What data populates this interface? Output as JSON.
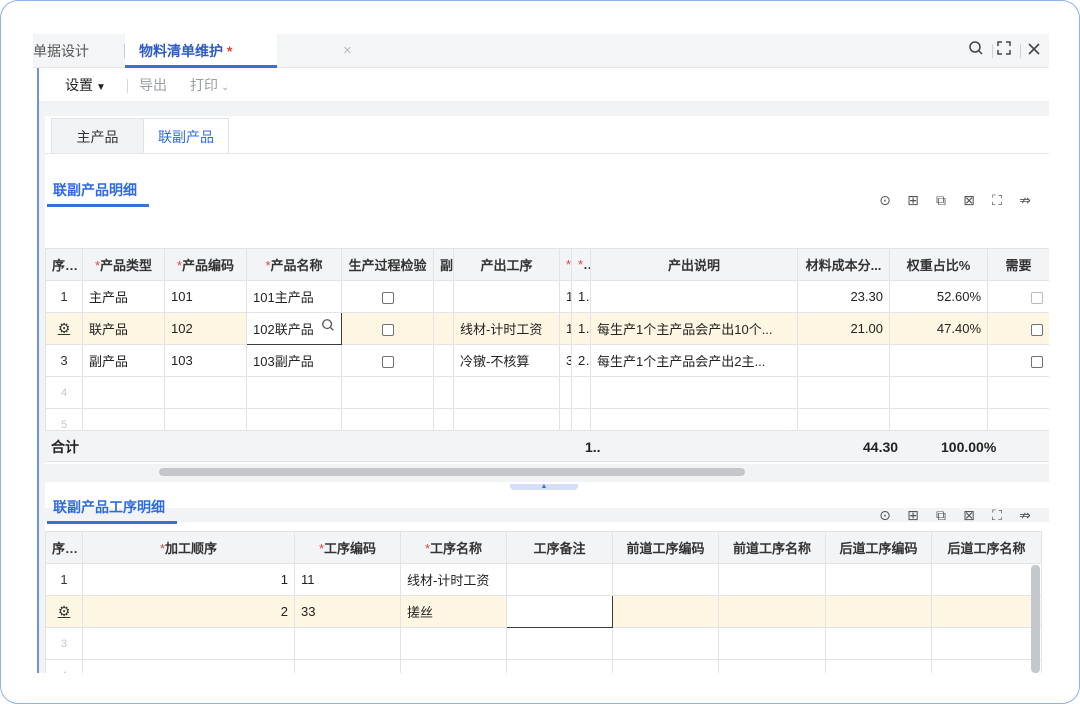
{
  "tabs": {
    "prev_label": "单据设计",
    "active_label": "物料清单维护",
    "active_star": "*",
    "close_glyph": "×"
  },
  "window_icons": {
    "search": "search-icon",
    "expand": "expand-icon",
    "close": "close-icon"
  },
  "toolbar": {
    "settings": "设置",
    "export": "导出",
    "print": "打印"
  },
  "subtabs": {
    "main": "主产品",
    "co": "联副产品"
  },
  "section1": {
    "title": "联副产品明细",
    "headers": [
      "序号",
      "产品类型",
      "产品编码",
      "产品名称",
      "生产过程检验",
      "副",
      "产出工序",
      "",
      "..",
      "产出说明",
      "材料成本分...",
      "权重占比%",
      "需要"
    ],
    "rows": [
      {
        "idx": "1",
        "type": "主产品",
        "code": "101",
        "name": "101主产品",
        "proc": "",
        "col_a": "1",
        "col_b": "1",
        "desc": "",
        "cost": "23.30",
        "weight": "52.60%"
      },
      {
        "idx": "",
        "type": "联产品",
        "code": "102",
        "name": "102联产品",
        "proc": "线材-计时工资",
        "col_a": "1",
        "col_b": "1",
        "desc": "每生产1个主产品会产出10个...",
        "cost": "21.00",
        "weight": "47.40%"
      },
      {
        "idx": "3",
        "type": "副产品",
        "code": "103",
        "name": "103副产品",
        "proc": "冷镦-不核算",
        "col_a": "3",
        "col_b": "2",
        "desc": "每生产1个主产品会产出2主...",
        "cost": "",
        "weight": ""
      },
      {
        "idx": "4"
      },
      {
        "idx": "5"
      }
    ],
    "summary": {
      "label": "合计",
      "qty": "1..",
      "cost": "44.30",
      "weight": "100.00%"
    }
  },
  "section2": {
    "title": "联副产品工序明细",
    "headers": [
      "序号",
      "加工顺序",
      "工序编码",
      "工序名称",
      "工序备注",
      "前道工序编码",
      "前道工序名称",
      "后道工序编码",
      "后道工序名称"
    ],
    "rows": [
      {
        "idx": "1",
        "seq": "1",
        "code": "11",
        "name": "线材-计时工资"
      },
      {
        "idx": "",
        "seq": "2",
        "code": "33",
        "name": "搓丝"
      },
      {
        "idx": "3"
      },
      {
        "idx": "4"
      }
    ]
  }
}
